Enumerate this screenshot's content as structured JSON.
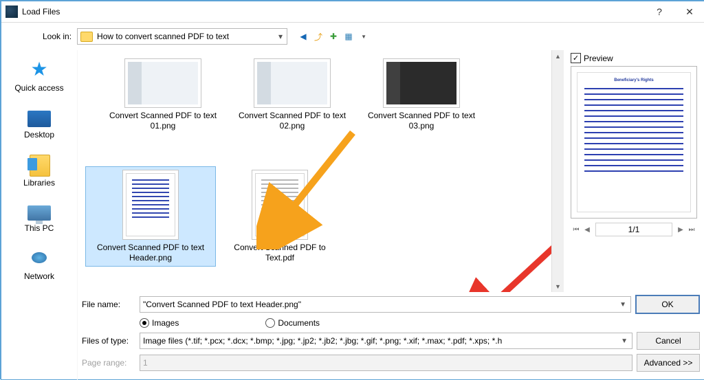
{
  "window_title": "Load Files",
  "look_in": {
    "label": "Look in:",
    "value": "How to convert scanned PDF to text"
  },
  "sidebar": {
    "items": [
      {
        "label": "Quick access"
      },
      {
        "label": "Desktop"
      },
      {
        "label": "Libraries"
      },
      {
        "label": "This PC"
      },
      {
        "label": "Network"
      }
    ]
  },
  "preview": {
    "checkbox_label": "Preview",
    "page_display": "1/1"
  },
  "files": [
    {
      "label": "Convert Scanned PDF to text 01.png",
      "kind": "screenshot"
    },
    {
      "label": "Convert Scanned PDF to text 02.png",
      "kind": "screenshot"
    },
    {
      "label": "Convert Scanned PDF to text 03.png",
      "kind": "screenshot-dark"
    },
    {
      "label": "Convert Scanned PDF to text Header.png",
      "kind": "doc",
      "selected": true
    },
    {
      "label": "Convert Scanned PDF to Text.pdf",
      "kind": "pdf"
    }
  ],
  "form": {
    "file_name_label": "File name:",
    "file_name_value": "\"Convert Scanned PDF to text Header.png\"",
    "filter_images_label": "Images",
    "filter_documents_label": "Documents",
    "files_of_type_label": "Files of type:",
    "files_of_type_value": "Image files (*.tif; *.pcx; *.dcx; *.bmp; *.jpg; *.jp2; *.jb2; *.jbg; *.gif; *.png; *.xif; *.max; *.pdf; *.xps; *.h",
    "page_range_label": "Page range:",
    "page_range_value": "1",
    "ok_label": "OK",
    "cancel_label": "Cancel",
    "advanced_label": "Advanced >>"
  }
}
